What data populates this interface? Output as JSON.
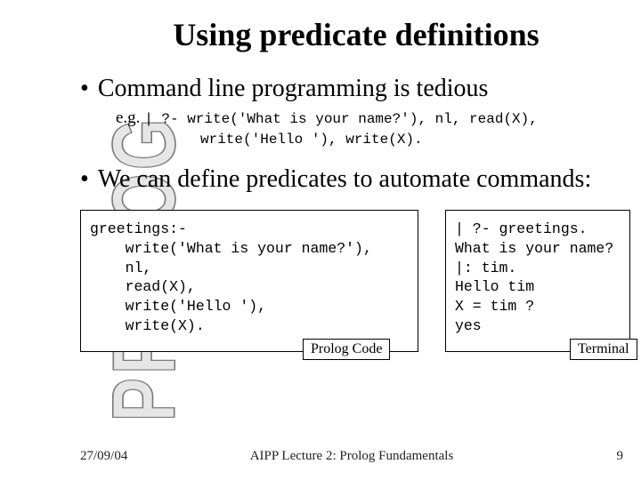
{
  "sidebar": {
    "word": "PROLOG"
  },
  "title": "Using predicate definitions",
  "bullets": {
    "b1": "Command line programming is tedious",
    "b2": "We can define predicates to automate commands:"
  },
  "example": {
    "prefix": "e.g.",
    "line1": "| ?- write('What is your name?'), nl, read(X),",
    "line2": "write('Hello '), write(X)."
  },
  "codebox_left": {
    "content": "greetings:-\n    write('What is your name?'),\n    nl,\n    read(X),\n    write('Hello '),\n    write(X).",
    "label": "Prolog Code"
  },
  "codebox_right": {
    "content": "| ?- greetings.\nWhat is your name?\n|: tim.\nHello tim\nX = tim ?\nyes",
    "label": "Terminal"
  },
  "footer": {
    "date": "27/09/04",
    "center": "AIPP Lecture 2: Prolog Fundamentals",
    "page": "9"
  }
}
